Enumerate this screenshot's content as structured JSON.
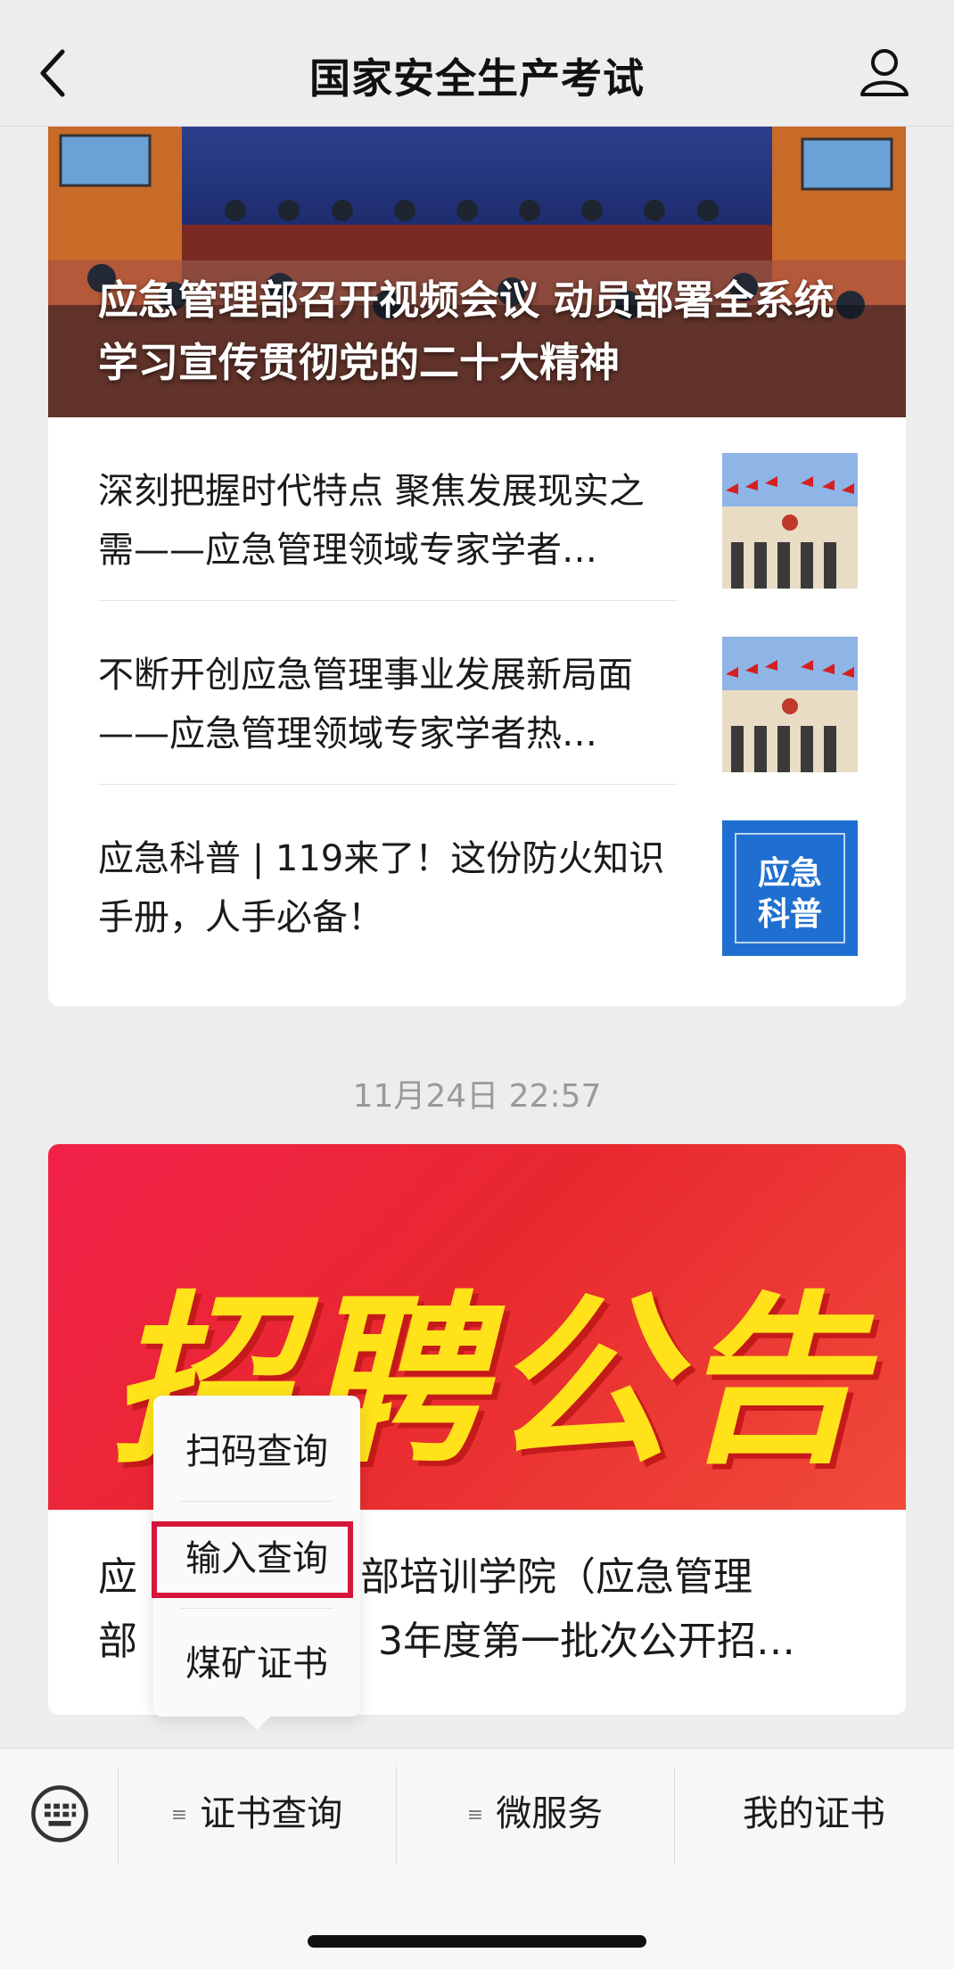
{
  "nav": {
    "title": "国家安全生产考试",
    "back_icon": "chevron-left-icon",
    "user_icon": "user-icon"
  },
  "card1": {
    "hero_title": "应急管理部召开视频会议 动员部署全系统学习宣传贯彻党的二十大精神",
    "articles": [
      {
        "title": "深刻把握时代特点 聚焦发展现实之需——应急管理领域专家学者…"
      },
      {
        "title": "不断开创应急管理事业发展新局面——应急管理领域专家学者热…"
      },
      {
        "title": "应急科普 | 119来了！这份防火知识手册，人手必备！",
        "thumb_text_1": "应急",
        "thumb_text_2": "科普"
      }
    ]
  },
  "timestamp": "11月24日 22:57",
  "card2": {
    "banner_text": "招聘公告",
    "title_left": "应",
    "title_right": "部培训学院（应急管理",
    "title_line2_left": "部",
    "title_line2_right": "3年度第一批次公开招…"
  },
  "popup": {
    "items": [
      "扫码查询",
      "输入查询",
      "煤矿证书"
    ],
    "selected": "输入查询"
  },
  "menubar": {
    "keyboard_icon": "keyboard-icon",
    "items": [
      {
        "label": "证书查询",
        "has_submenu": true
      },
      {
        "label": "微服务",
        "has_submenu": true
      },
      {
        "label": "我的证书",
        "has_submenu": false
      }
    ]
  },
  "colors": {
    "highlight": "#d4163a",
    "banner_red": "#e8282f",
    "banner_yellow": "#ffe21a",
    "page_bg": "#ededed"
  }
}
